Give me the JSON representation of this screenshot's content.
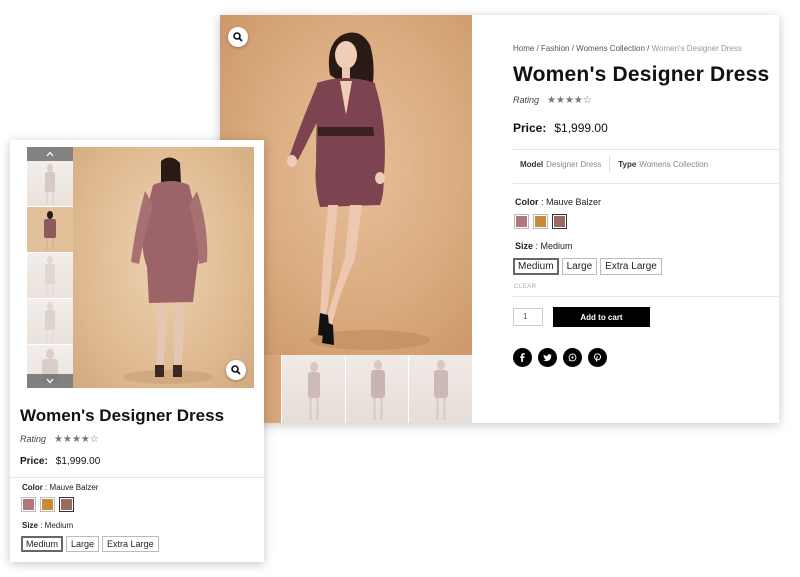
{
  "main": {
    "breadcrumb": {
      "home": "Home",
      "sep1": " / ",
      "fashion": "Fashion",
      "sep2": " / ",
      "collection": "Womens Collection",
      "sep3": " / ",
      "current": "Women's Designer Dress"
    },
    "title": "Women's Designer Dress",
    "rating_label": "Rating",
    "stars": "★★★★☆",
    "price_label": "Price:",
    "price": "$1,999.00",
    "meta": {
      "model_label": "Model",
      "model_value": "Designer Dress",
      "type_label": "Type",
      "type_value": "Womens Collection"
    },
    "color_label": "Color",
    "color_value": " : Mauve Balzer",
    "size_label": "Size",
    "size_value": " : Medium",
    "sizes": [
      "Medium",
      "Large",
      "Extra Large"
    ],
    "selected_size": "Medium",
    "clear": "CLEAR",
    "qty": "1",
    "add_to_cart": "Add to cart",
    "socials": [
      "facebook-icon",
      "twitter-icon",
      "whatsapp-icon",
      "pinterest-icon"
    ]
  },
  "side": {
    "title": "Women's Designer Dress",
    "rating_label": "Rating",
    "stars": "★★★★☆",
    "price_label": "Price:",
    "price": "$1,999.00",
    "color_label": "Color",
    "color_value": " : Mauve Balzer",
    "size_label": "Size",
    "size_value": " : Medium",
    "sizes": [
      "Medium",
      "Large",
      "Extra Large"
    ]
  },
  "colors": {
    "swatch_mauve": "#b0787a",
    "swatch_mustard": "#c98a3a",
    "swatch_rose": "#9a6a62",
    "dress": "#7d4350",
    "button_bg": "#000000"
  }
}
